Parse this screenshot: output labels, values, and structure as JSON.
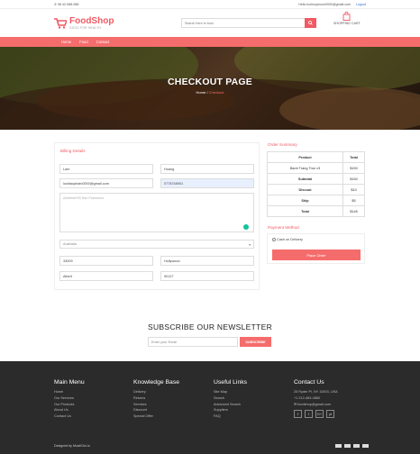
{
  "topbar": {
    "phone": "98 42-988-988",
    "email": "Hello.tuchsuphuon0000@gmail.com",
    "logout": "Logout"
  },
  "logo": {
    "brand": "FoodShop",
    "tagline": "GOOD FOR HEALTH"
  },
  "search": {
    "placeholder": "Search here to food"
  },
  "shopping_cart": {
    "label": "SHOPPING CART"
  },
  "nav": {
    "items": [
      "Home",
      "Food",
      "Contact"
    ]
  },
  "hero": {
    "title": "CHECKOUT PAGE",
    "crumb_home": "Home",
    "crumb_sep": "/",
    "crumb_current": "Checkout"
  },
  "billing": {
    "title": "Billing Details",
    "first_name": "Lam",
    "last_name": "Hoang",
    "email": "lucktauphain0000@gmail.com",
    "phone": "0778748901",
    "address_placeholder": "Address*93 San Francisco",
    "country": "Australia",
    "zip": "33009",
    "city": "Hollywood",
    "state": "Albert",
    "postcode": "90127"
  },
  "order": {
    "title": "Order Summary",
    "headers": [
      "Product",
      "Total"
    ],
    "rows": [
      {
        "label": "Banh Trang Tron  x3",
        "value": "$150",
        "bold": false
      },
      {
        "label": "Subtotal",
        "value": "$150",
        "bold": true
      },
      {
        "label": "Discout",
        "value": "$10",
        "bold": true
      },
      {
        "label": "Ship",
        "value": "$5",
        "bold": true
      },
      {
        "label": "Total",
        "value": "$145",
        "bold": true
      }
    ]
  },
  "payment": {
    "title": "Payment Method",
    "option": "Cash on Delivery",
    "button": "Place Order"
  },
  "newsletter": {
    "title": "SUBSCRIBE OUR NEWSLETTER",
    "placeholder": "Enter your Email",
    "button": "SUBSCRIBE"
  },
  "footer": {
    "main_menu": {
      "title": "Main Menu",
      "items": [
        "Home",
        "Our Services",
        "Our Products",
        "About Us",
        "Contact Us"
      ]
    },
    "knowledge": {
      "title": "Knowledge Base",
      "items": [
        "Delivery",
        "Returns",
        "Services",
        "Discount",
        "Special Offer"
      ]
    },
    "useful": {
      "title": "Useful Links",
      "items": [
        "Site Map",
        "Search",
        "Advanced Search",
        "Suppliers",
        "FAQ"
      ]
    },
    "contact": {
      "title": "Contact Us",
      "address": "25 Ryder Pl, NY 10003, USA",
      "phone": "+1 212-463-4580",
      "email": "foodshop@gmail.com"
    },
    "socials": [
      "f",
      "t",
      "G+",
      "yt"
    ],
    "designed": "Designed by MoaKGui.io"
  },
  "colors": {
    "accent": "#f56c6c",
    "footer_bg": "#2b2b2b"
  }
}
